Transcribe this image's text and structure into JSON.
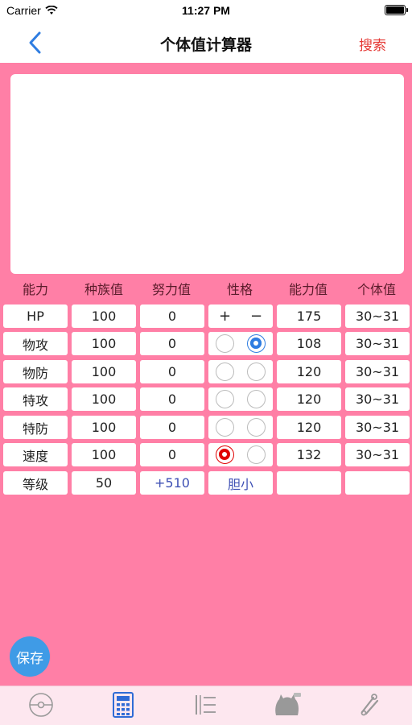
{
  "status": {
    "carrier": "Carrier",
    "time": "11:27 PM"
  },
  "nav": {
    "title": "个体值计算器",
    "search": "搜索"
  },
  "table": {
    "headers": [
      "能力",
      "种族值",
      "努力值",
      "性格",
      "能力值",
      "个体值"
    ],
    "rows": [
      {
        "stat": "HP",
        "base": "100",
        "ev": "0",
        "plus": "+",
        "minus": "−",
        "value": "175",
        "iv": "30~31"
      },
      {
        "stat": "物攻",
        "base": "100",
        "ev": "0",
        "plus_state": "off",
        "minus_state": "on",
        "value": "108",
        "iv": "30~31"
      },
      {
        "stat": "物防",
        "base": "100",
        "ev": "0",
        "plus_state": "off",
        "minus_state": "off",
        "value": "120",
        "iv": "30~31"
      },
      {
        "stat": "特攻",
        "base": "100",
        "ev": "0",
        "plus_state": "off",
        "minus_state": "off",
        "value": "120",
        "iv": "30~31"
      },
      {
        "stat": "特防",
        "base": "100",
        "ev": "0",
        "plus_state": "off",
        "minus_state": "off",
        "value": "120",
        "iv": "30~31"
      },
      {
        "stat": "速度",
        "base": "100",
        "ev": "0",
        "plus_state": "on",
        "minus_state": "off",
        "value": "132",
        "iv": "30~31"
      }
    ],
    "level": {
      "label": "等级",
      "value": "50",
      "ev_remaining": "+510",
      "nature": "胆小",
      "value_empty": "",
      "iv_empty": ""
    }
  },
  "save_button": "保存",
  "colors": {
    "background": "#ff7fa6",
    "accent_blue": "#2f7de1",
    "accent_red": "#e00000",
    "search_red": "#e53935"
  },
  "tabbar": {
    "active_index": 1,
    "icons": [
      "pokeball-icon",
      "calculator-icon",
      "list-icon",
      "monster-icon",
      "tools-icon"
    ]
  }
}
